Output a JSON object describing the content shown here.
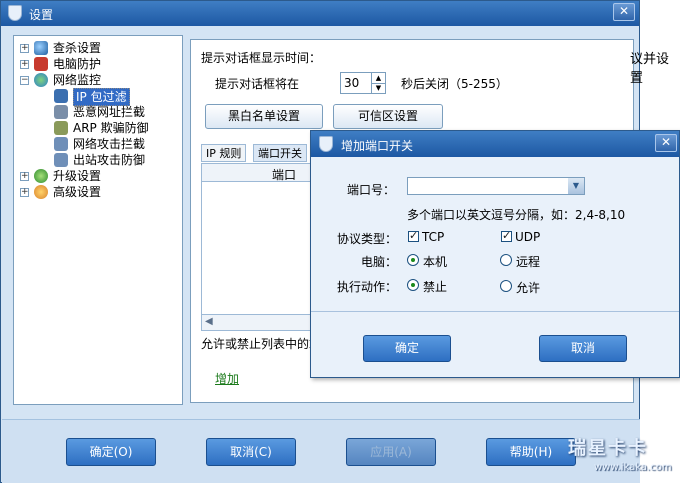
{
  "main_window": {
    "title": "设置",
    "close_glyph": "✕"
  },
  "tree": {
    "items": [
      {
        "label": "查杀设置",
        "expander": "+"
      },
      {
        "label": "电脑防护",
        "expander": "+"
      },
      {
        "label": "网络监控",
        "expander": "−"
      },
      {
        "label": "IP 包过滤"
      },
      {
        "label": "恶意网址拦截"
      },
      {
        "label": "ARP 欺骗防御"
      },
      {
        "label": "网络攻击拦截"
      },
      {
        "label": "出站攻击防御"
      },
      {
        "label": "升级设置",
        "expander": "+"
      },
      {
        "label": "高级设置",
        "expander": "+"
      }
    ]
  },
  "panel": {
    "prompt_heading": "提示对话框显示时间：",
    "prompt_prefix": "提示对话框将在",
    "prompt_value": "30",
    "prompt_suffix": "秒后关闭（5-255）",
    "blackwhite_button": "黑白名单设置",
    "trusted_button": "可信区设置",
    "tabs": [
      "IP 规则",
      "端口开关"
    ],
    "column_header": "端口",
    "footer_text": "允许或禁止列表中的端",
    "add_link": "增加"
  },
  "bottom": {
    "ok": "确定(O)",
    "cancel": "取消(C)",
    "apply": "应用(A)",
    "help": "帮助(H)"
  },
  "right_edge_text": "议并设置",
  "watermark": {
    "brand": "瑞星卡卡",
    "url": "www.ikaka.com"
  },
  "dialog": {
    "title": "增加端口开关",
    "close_glyph": "✕",
    "port_label": "端口号：",
    "port_value": "",
    "port_hint": "多个端口以英文逗号分隔，如：2,4-8,10",
    "protocol_label": "协议类型：",
    "tcp_label": "TCP",
    "udp_label": "UDP",
    "computer_label": "电脑：",
    "local_label": "本机",
    "remote_label": "远程",
    "action_label": "执行动作：",
    "deny_label": "禁止",
    "allow_label": "允许",
    "ok_button": "确定",
    "cancel_button": "取消"
  },
  "colors": {
    "title_bar": "#1d58a3",
    "window_bg": "#d4e4f4",
    "selection": "#316ac5",
    "link_green": "#1b7a1b"
  }
}
